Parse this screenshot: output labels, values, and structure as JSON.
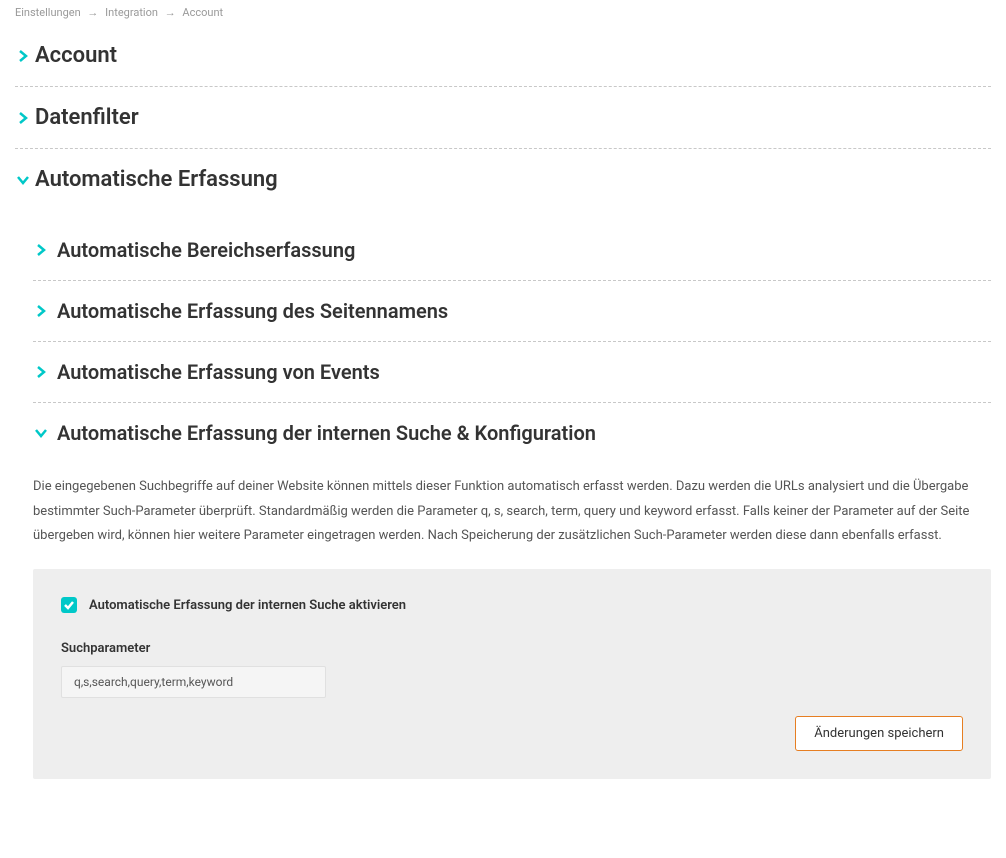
{
  "breadcrumb": {
    "item0": "Einstellungen",
    "item1": "Integration",
    "item2": "Account"
  },
  "sections": {
    "account": {
      "title": "Account"
    },
    "datafilter": {
      "title": "Datenfilter"
    },
    "autocapture": {
      "title": "Automatische Erfassung",
      "sub_area": {
        "title": "Automatische Bereichserfassung"
      },
      "sub_pagename": {
        "title": "Automatische Erfassung des Seitennamens"
      },
      "sub_events": {
        "title": "Automatische Erfassung von Events"
      },
      "sub_search": {
        "title": "Automatische Erfassung der internen Suche & Konfiguration",
        "description": "Die eingegebenen Suchbegriffe auf deiner Website können mittels dieser Funktion automatisch erfasst werden. Dazu werden die URLs analysiert und die Übergabe bestimmter Such-Parameter überprüft. Standardmäßig werden die Parameter q, s, search, term, query und keyword erfasst. Falls keiner der Parameter auf der Seite übergeben wird, können hier weitere Parameter eingetragen werden. Nach Speicherung der zusätzlichen Such-Parameter werden diese dann ebenfalls erfasst.",
        "checkbox_label": "Automatische Erfassung der internen Suche aktivieren",
        "param_label": "Suchparameter",
        "param_value": "q,s,search,query,term,keyword",
        "save_label": "Änderungen speichern"
      }
    }
  }
}
